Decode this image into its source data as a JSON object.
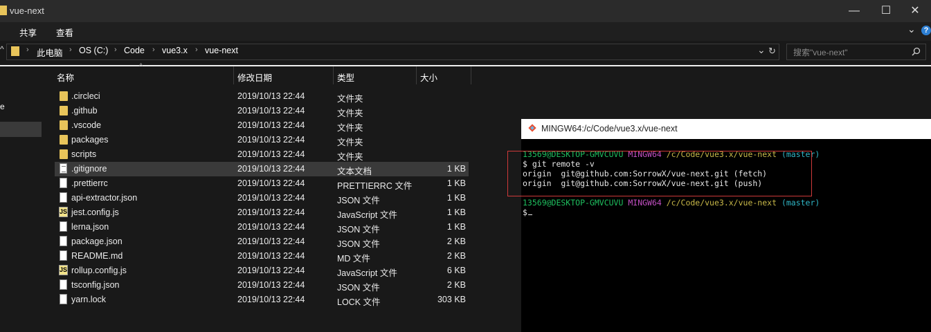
{
  "window": {
    "title": "vue-next",
    "controls": {
      "minimize": "—",
      "maximize": "☐",
      "close": "✕"
    }
  },
  "ribbon": {
    "tabs": [
      "共享",
      "查看"
    ],
    "expand_icon": "⌄",
    "help_icon": "?"
  },
  "address_bar": {
    "up_arrow": "^",
    "breadcrumbs": [
      "此电脑",
      "OS (C:)",
      "Code",
      "vue3.x",
      "vue-next"
    ],
    "dropdown": "⌄",
    "refresh": "↻",
    "search_placeholder": "搜索\"vue-next\""
  },
  "nav_pane": {
    "edge_text": "e"
  },
  "file_list": {
    "columns": [
      "名称",
      "修改日期",
      "类型",
      "大小"
    ],
    "sort_indicator": "^",
    "rows": [
      {
        "name": ".circleci",
        "date": "2019/10/13 22:44",
        "type": "文件夹",
        "size": "",
        "icon": "folder"
      },
      {
        "name": ".github",
        "date": "2019/10/13 22:44",
        "type": "文件夹",
        "size": "",
        "icon": "folder"
      },
      {
        "name": ".vscode",
        "date": "2019/10/13 22:44",
        "type": "文件夹",
        "size": "",
        "icon": "folder"
      },
      {
        "name": "packages",
        "date": "2019/10/13 22:44",
        "type": "文件夹",
        "size": "",
        "icon": "folder"
      },
      {
        "name": "scripts",
        "date": "2019/10/13 22:44",
        "type": "文件夹",
        "size": "",
        "icon": "folder"
      },
      {
        "name": ".gitignore",
        "date": "2019/10/13 22:44",
        "type": "文本文档",
        "size": "1 KB",
        "icon": "text-file"
      },
      {
        "name": ".prettierrc",
        "date": "2019/10/13 22:44",
        "type": "PRETTIERRC 文件",
        "size": "1 KB",
        "icon": "file"
      },
      {
        "name": "api-extractor.json",
        "date": "2019/10/13 22:44",
        "type": "JSON 文件",
        "size": "1 KB",
        "icon": "file"
      },
      {
        "name": "jest.config.js",
        "date": "2019/10/13 22:44",
        "type": "JavaScript 文件",
        "size": "1 KB",
        "icon": "js-file"
      },
      {
        "name": "lerna.json",
        "date": "2019/10/13 22:44",
        "type": "JSON 文件",
        "size": "1 KB",
        "icon": "file"
      },
      {
        "name": "package.json",
        "date": "2019/10/13 22:44",
        "type": "JSON 文件",
        "size": "2 KB",
        "icon": "file"
      },
      {
        "name": "README.md",
        "date": "2019/10/13 22:44",
        "type": "MD 文件",
        "size": "2 KB",
        "icon": "file"
      },
      {
        "name": "rollup.config.js",
        "date": "2019/10/13 22:44",
        "type": "JavaScript 文件",
        "size": "6 KB",
        "icon": "js-file"
      },
      {
        "name": "tsconfig.json",
        "date": "2019/10/13 22:44",
        "type": "JSON 文件",
        "size": "2 KB",
        "icon": "file"
      },
      {
        "name": "yarn.lock",
        "date": "2019/10/13 22:44",
        "type": "LOCK 文件",
        "size": "303 KB",
        "icon": "file"
      }
    ],
    "selected_row": ".gitignore"
  },
  "terminal": {
    "title": "MINGW64:/c/Code/vue3.x/vue-next",
    "prompt1": {
      "user": "13569@DESKTOP-GMVCUVU",
      "env": "MINGW64",
      "path": "/c/Code/vue3.x/vue-next",
      "branch": "(master)"
    },
    "command": "$ git remote -v",
    "output": [
      "origin  git@github.com:SorrowX/vue-next.git (fetch)",
      "origin  git@github.com:SorrowX/vue-next.git (push)"
    ],
    "prompt2": {
      "user": "13569@DESKTOP-GMVCUVU",
      "env": "MINGW64",
      "path": "/c/Code/vue3.x/vue-next",
      "branch": "(master)"
    },
    "cursor_line": "$",
    "colors": {
      "user": "#1fbf5f",
      "env": "#c14fc1",
      "path": "#c9b949",
      "branch": "#2fb6c6",
      "text": "#e6e6e6"
    }
  }
}
